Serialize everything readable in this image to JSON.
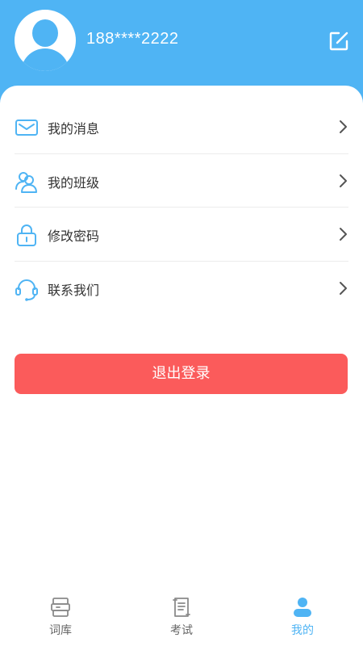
{
  "colors": {
    "accent": "#4fb4f4",
    "danger": "#fb5b5b",
    "text": "#333333",
    "muted": "#666666"
  },
  "profile": {
    "phone": "188****2222",
    "avatar_icon": "user-avatar-icon",
    "edit_icon": "edit-icon"
  },
  "menu": {
    "items": [
      {
        "label": "我的消息",
        "icon": "mail-icon"
      },
      {
        "label": "我的班级",
        "icon": "users-icon"
      },
      {
        "label": "修改密码",
        "icon": "lock-icon"
      },
      {
        "label": "联系我们",
        "icon": "headset-icon"
      }
    ]
  },
  "logout": {
    "label": "退出登录"
  },
  "tabbar": {
    "tabs": [
      {
        "label": "词库",
        "icon": "book-stack-icon",
        "active": false
      },
      {
        "label": "考试",
        "icon": "exam-paper-icon",
        "active": false
      },
      {
        "label": "我的",
        "icon": "profile-icon",
        "active": true
      }
    ]
  }
}
